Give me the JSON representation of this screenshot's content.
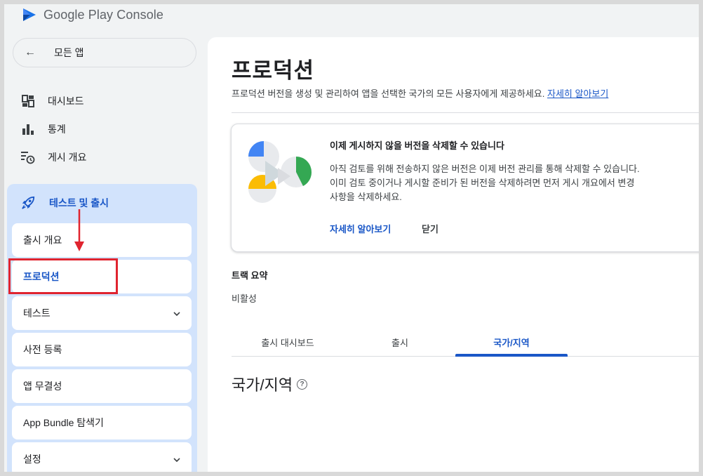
{
  "app": {
    "logo_google": "Google Play",
    "logo_console": "Console"
  },
  "sidebar": {
    "back_label": "모든 앱",
    "items": [
      {
        "label": "대시보드",
        "icon": "dashboard-icon"
      },
      {
        "label": "통계",
        "icon": "bar-chart-icon"
      },
      {
        "label": "게시 개요",
        "icon": "publishing-overview-icon"
      }
    ],
    "group": {
      "label": "테스트 및 출시",
      "icon": "rocket-icon",
      "subitems": [
        {
          "label": "출시 개요",
          "expandable": false
        },
        {
          "label": "프로덕션",
          "expandable": false,
          "active": true
        },
        {
          "label": "테스트",
          "expandable": true
        },
        {
          "label": "사전 등록",
          "expandable": false
        },
        {
          "label": "앱 무결성",
          "expandable": false
        },
        {
          "label": "App Bundle 탐색기",
          "expandable": false
        },
        {
          "label": "설정",
          "expandable": true
        }
      ]
    }
  },
  "main": {
    "title": "프로덕션",
    "description": "프로덕션 버전을 생성 및 관리하여 앱을 선택한 국가의 모든 사용자에게 제공하세요.",
    "learn_more": "자세히 알아보기",
    "card": {
      "title": "이제 게시하지 않을 버전을 삭제할 수 있습니다",
      "body_line1": "아직 검토를 위해 전송하지 않은 버전은 이제 버전 관리를 통해 삭제할 수 있습니다.",
      "body_line2": "이미 검토 중이거나 게시할 준비가 된 버전을 삭제하려면 먼저 게시 개요에서 변경",
      "body_line3": "사항을 삭제하세요.",
      "learn_more": "자세히 알아보기",
      "close": "닫기"
    },
    "track_summary_label": "트랙 요약",
    "track_summary_value": "비활성",
    "tabs": [
      {
        "label": "출시 대시보드",
        "active": false
      },
      {
        "label": "출시",
        "active": false
      },
      {
        "label": "국가/지역",
        "active": true
      }
    ],
    "section_title": "국가/지역"
  },
  "colors": {
    "accent": "#1a57c7",
    "highlight_group": "#d2e3fc",
    "annotation_red": "#e0242f"
  }
}
